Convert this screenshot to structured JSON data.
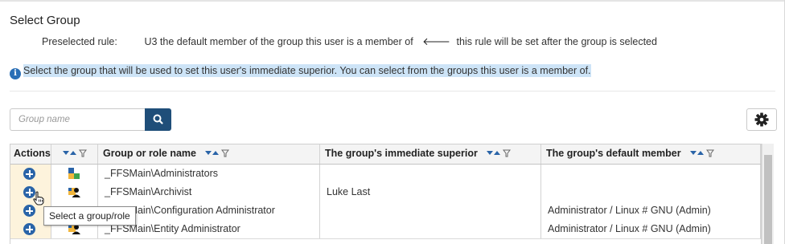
{
  "dialog": {
    "title": "Select Group",
    "preselected_label": "Preselected rule:",
    "preselected_value": "U3 the default member of the group this user is a member of",
    "preselected_note": "this rule will be set after the group is selected",
    "info_text": "Select the group that will be used to set this user's immediate superior. You can select from the groups this user is a member of."
  },
  "search": {
    "placeholder": "Group name",
    "button_icon": "search-icon"
  },
  "settings": {
    "icon": "gear-icon"
  },
  "table": {
    "columns": [
      "Actions",
      "",
      "Group or role name",
      "The group's immediate superior",
      "The group's default member"
    ],
    "rows": [
      {
        "type_icon": "group-icon",
        "name": "_FFSMain\\Administrators",
        "superior": "",
        "default_member": ""
      },
      {
        "type_icon": "role-icon",
        "name": "_FFSMain\\Archivist",
        "superior": "Luke Last",
        "default_member": ""
      },
      {
        "type_icon": "role-icon",
        "name": "_FFSMain\\Configuration Administrator",
        "superior": "",
        "default_member": "Administrator / Linux # GNU (Admin)"
      },
      {
        "type_icon": "role-icon",
        "name": "_FFSMain\\Entity Administrator",
        "superior": "",
        "default_member": "Administrator / Linux # GNU (Admin)"
      }
    ]
  },
  "tooltip": {
    "text": "Select a group/role"
  },
  "colors": {
    "accent": "#1f4e79",
    "add_icon": "#2a64a8",
    "info_highlight": "#cde4f7",
    "actions_cell": "#fdf3dc"
  }
}
